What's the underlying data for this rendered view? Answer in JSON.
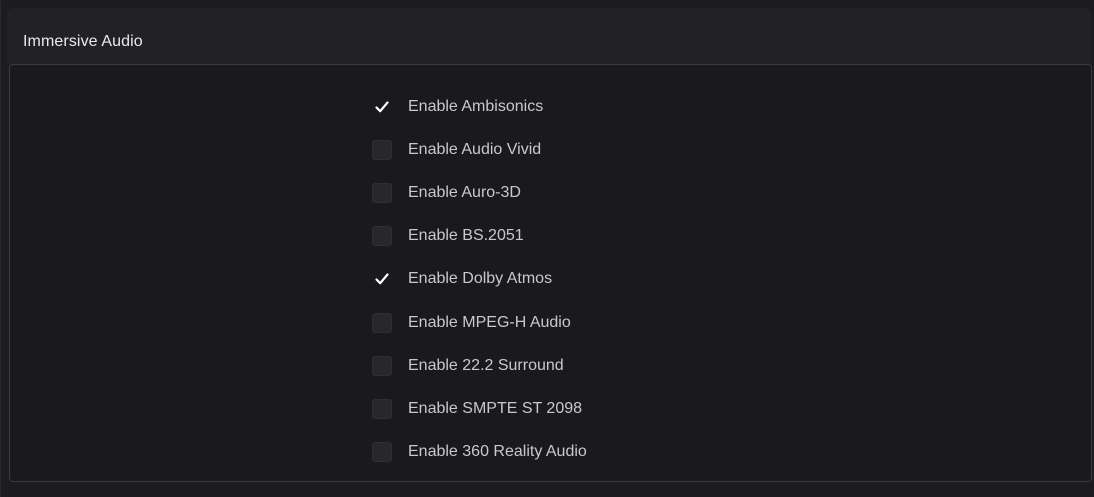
{
  "header": {
    "title": "Immersive Audio"
  },
  "options": [
    {
      "label": "Enable Ambisonics",
      "checked": true
    },
    {
      "label": "Enable Audio Vivid",
      "checked": false
    },
    {
      "label": "Enable Auro-3D",
      "checked": false
    },
    {
      "label": "Enable BS.2051",
      "checked": false
    },
    {
      "label": "Enable Dolby Atmos",
      "checked": true
    },
    {
      "label": "Enable MPEG-H Audio",
      "checked": false
    },
    {
      "label": "Enable 22.2 Surround",
      "checked": false
    },
    {
      "label": "Enable SMPTE ST 2098",
      "checked": false
    },
    {
      "label": "Enable 360 Reality Audio",
      "checked": false
    }
  ],
  "colors": {
    "check": "#ffffff",
    "text": "#c9c9cb",
    "panel": "#1a1a1e"
  }
}
